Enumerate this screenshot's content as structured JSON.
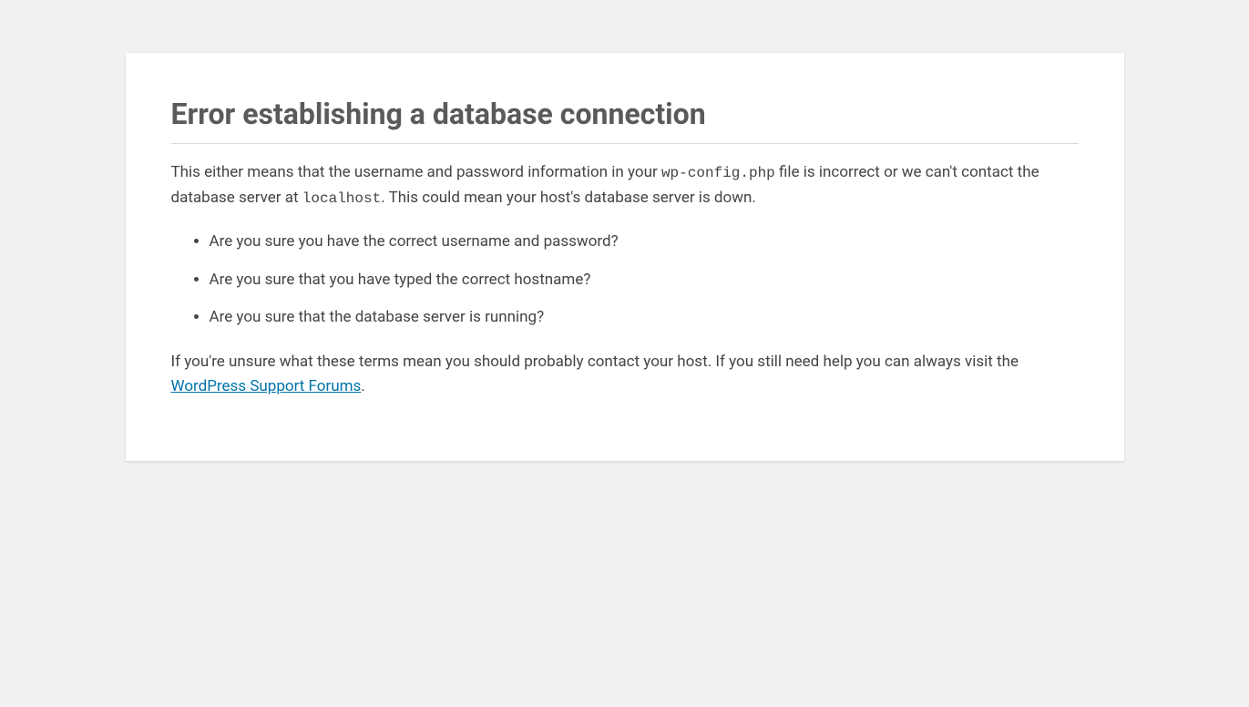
{
  "title": "Error establishing a database connection",
  "intro": {
    "part1": "This either means that the username and password information in your ",
    "code1": "wp-config.php",
    "part2": " file is incorrect or we can't contact the database server at ",
    "code2": "localhost",
    "part3": ". This could mean your host's database server is down."
  },
  "checks": [
    "Are you sure you have the correct username and password?",
    "Are you sure that you have typed the correct hostname?",
    "Are you sure that the database server is running?"
  ],
  "help": {
    "part1": "If you're unsure what these terms mean you should probably contact your host. If you still need help you can always visit the ",
    "link_text": "WordPress Support Forums",
    "part2": "."
  }
}
